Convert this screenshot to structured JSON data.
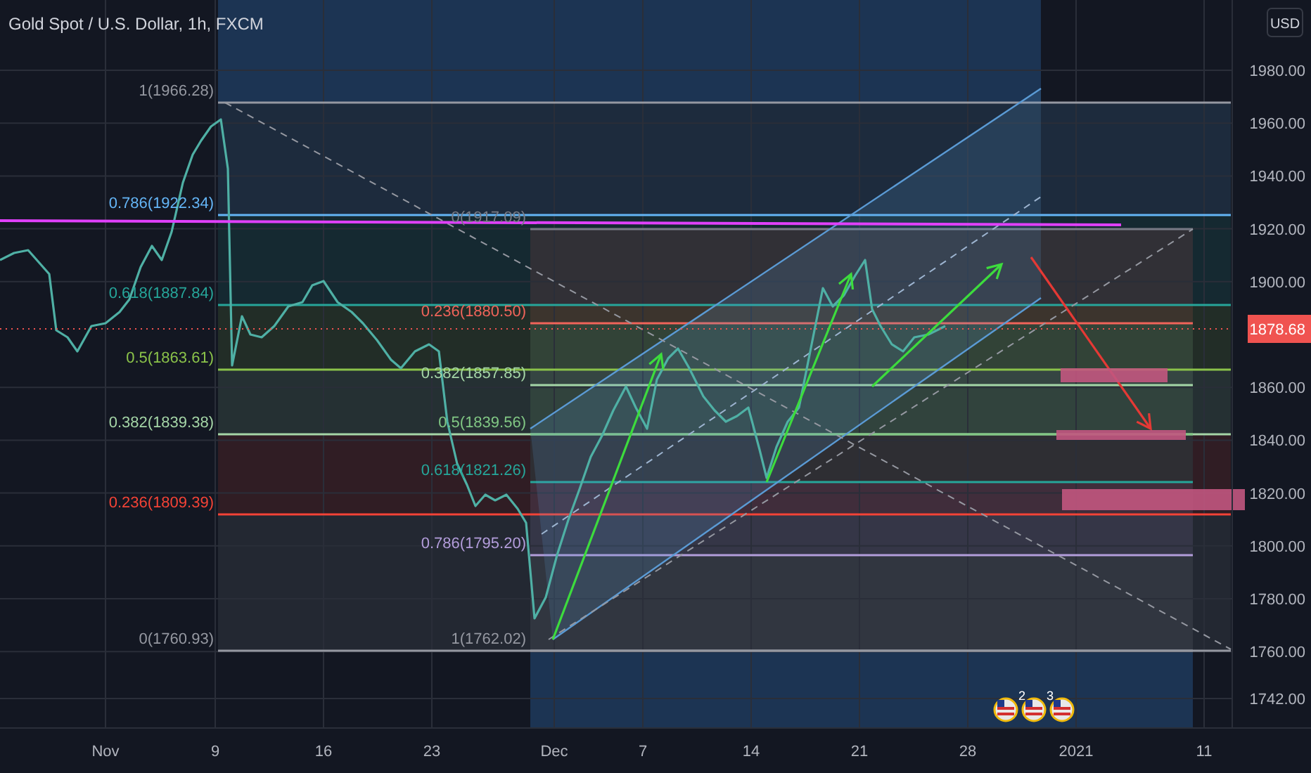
{
  "chart": {
    "title": "Gold Spot / U.S. Dollar, 1h, FXCM",
    "currency": "USD",
    "current_price": "1878.68",
    "price_axis": [
      "1980.00",
      "1960.00",
      "1940.00",
      "1920.00",
      "1900.00",
      "1860.00",
      "1840.00",
      "1820.00",
      "1800.00",
      "1780.00",
      "1760.00",
      "1742.00"
    ],
    "time_axis": [
      "Nov",
      "9",
      "16",
      "23",
      "Dec",
      "7",
      "14",
      "21",
      "28",
      "2021",
      "11"
    ],
    "fib_retracements": [
      {
        "levels": [
          {
            "label": "1(1966.28)",
            "color": "#9598a1"
          },
          {
            "label": "0.786(1922.34)",
            "color": "#64b5f6"
          },
          {
            "label": "0.618(1887.84)",
            "color": "#26a69a"
          },
          {
            "label": "0.5(1863.61)",
            "color": "#8bc34a"
          },
          {
            "label": "0.382(1839.38)",
            "color": "#a5d6a7"
          },
          {
            "label": "0.236(1809.39)",
            "color": "#f44336"
          },
          {
            "label": "0(1760.93)",
            "color": "#9598a1"
          }
        ]
      },
      {
        "levels": [
          {
            "label": "0(1917.09)",
            "color": "#787b86"
          },
          {
            "label": "0.236(1880.50)",
            "color": "#f0645a"
          },
          {
            "label": "0.382(1857.85)",
            "color": "#a5d6a7"
          },
          {
            "label": "0.5(1839.56)",
            "color": "#81c784"
          },
          {
            "label": "0.618(1821.26)",
            "color": "#26a69a"
          },
          {
            "label": "0.786(1795.20)",
            "color": "#b39ddb"
          },
          {
            "label": "1(1762.02)",
            "color": "#9598a1"
          }
        ]
      }
    ],
    "event_counts": [
      "2",
      "3"
    ]
  }
}
